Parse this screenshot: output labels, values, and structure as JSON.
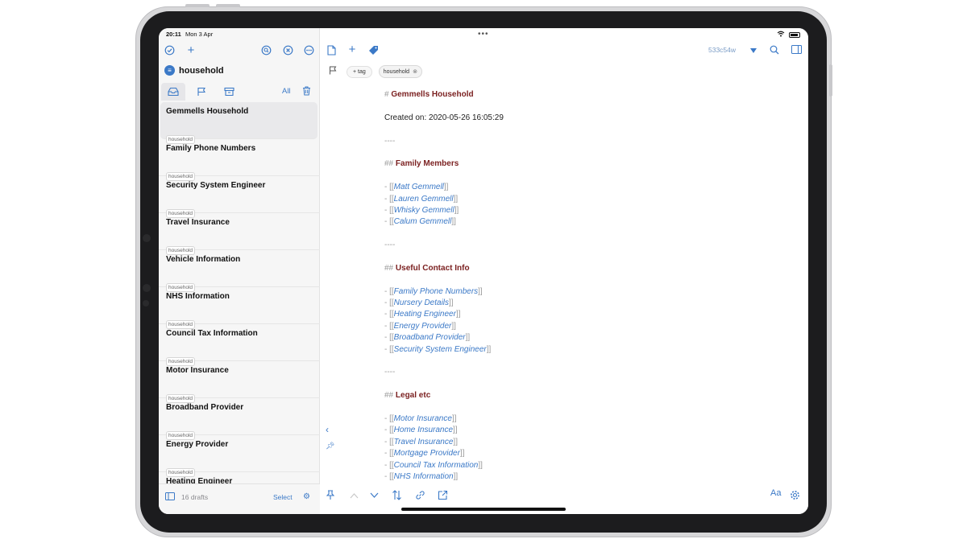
{
  "status_bar": {
    "time": "20:11",
    "date": "Mon 3 Apr"
  },
  "sidebar": {
    "workspace": "household",
    "tab_all": "All",
    "drafts": [
      {
        "title": "Gemmells Household",
        "tag": "household",
        "selected": true
      },
      {
        "title": "Family Phone Numbers",
        "tag": "household"
      },
      {
        "title": "Security System Engineer",
        "tag": "household"
      },
      {
        "title": "Travel Insurance",
        "tag": "household"
      },
      {
        "title": "Vehicle Information",
        "tag": "household"
      },
      {
        "title": "NHS Information",
        "tag": "household"
      },
      {
        "title": "Council Tax Information",
        "tag": "household"
      },
      {
        "title": "Motor Insurance",
        "tag": "household"
      },
      {
        "title": "Broadband Provider",
        "tag": "household"
      },
      {
        "title": "Energy Provider",
        "tag": "household"
      },
      {
        "title": "Heating Engineer",
        "tag": "household"
      }
    ],
    "drafts_count": "16 drafts",
    "select_label": "Select"
  },
  "editor": {
    "draft_hash": "533c54w",
    "add_tag_label": "+ tag",
    "tags": [
      "household"
    ],
    "heading_mark": "#",
    "subheading_mark": "##",
    "title": "Gemmells Household",
    "created": "Created on: 2020-05-26 16:05:29",
    "rule": "----",
    "sections": [
      {
        "heading": "Family Members",
        "links": [
          "Matt Gemmell",
          "Lauren Gemmell",
          "Whisky Gemmell",
          "Calum Gemmell"
        ]
      },
      {
        "heading": "Useful Contact Info",
        "links": [
          "Family Phone Numbers",
          "Nursery Details",
          "Heating Engineer",
          "Energy Provider",
          "Broadband Provider",
          "Security System Engineer"
        ]
      },
      {
        "heading": "Legal etc",
        "links": [
          "Motor Insurance",
          "Home Insurance",
          "Travel Insurance",
          "Mortgage Provider",
          "Council Tax Information",
          "NHS Information"
        ]
      }
    ],
    "font_button": "Aa"
  },
  "accent_color": "#3b79c7",
  "heading_color": "#7a1f1f"
}
